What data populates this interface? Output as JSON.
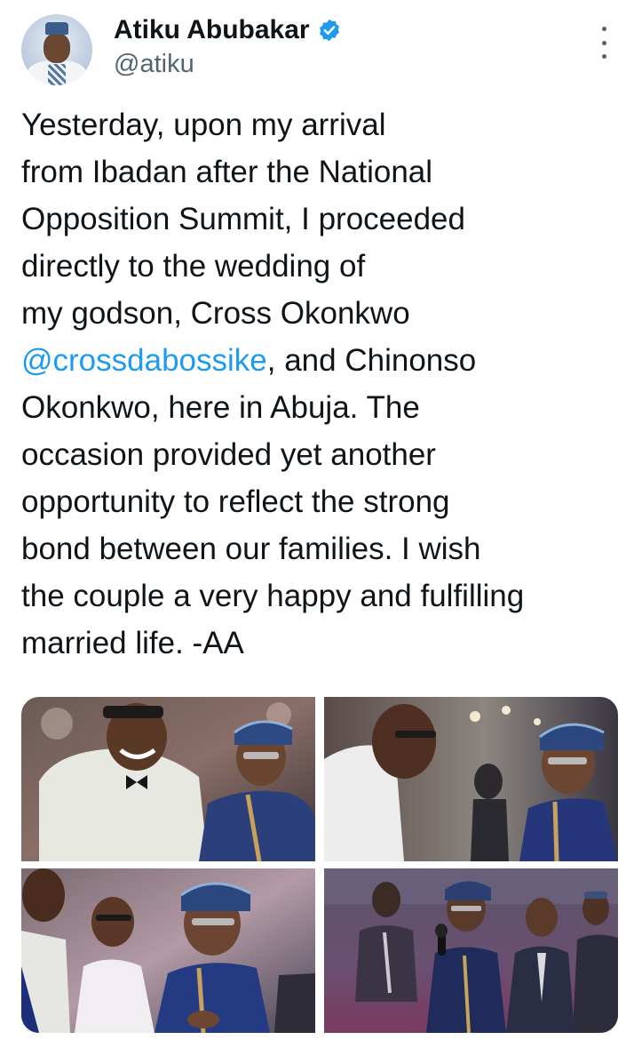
{
  "tweet": {
    "author": {
      "display_name": "Atiku Abubakar",
      "handle": "@atiku",
      "verified": true
    },
    "text_lines": [
      {
        "before": "Yesterday, upon my arrival",
        "mention": "",
        "after": ""
      },
      {
        "before": "from Ibadan after the National",
        "mention": "",
        "after": ""
      },
      {
        "before": "Opposition Summit, I proceeded",
        "mention": "",
        "after": ""
      },
      {
        "before": "directly to the wedding of",
        "mention": "",
        "after": ""
      },
      {
        "before": "my godson, Cross Okonkwo",
        "mention": "",
        "after": ""
      },
      {
        "before": "",
        "mention": "@crossdabossike",
        "after": ", and Chinonso"
      },
      {
        "before": "Okonkwo, here in Abuja. The",
        "mention": "",
        "after": ""
      },
      {
        "before": "occasion provided yet another",
        "mention": "",
        "after": ""
      },
      {
        "before": "opportunity to reflect the strong",
        "mention": "",
        "after": ""
      },
      {
        "before": "bond between our families. I wish",
        "mention": "",
        "after": ""
      },
      {
        "before": "the couple a very happy and fulfilling",
        "mention": "",
        "after": ""
      },
      {
        "before": "married life. -AA",
        "mention": "",
        "after": ""
      }
    ],
    "media_count": 4
  },
  "icons": {
    "verified": "verified-badge-icon",
    "more": "more-options-icon"
  },
  "colors": {
    "text": "#0f1419",
    "secondary": "#536471",
    "accent": "#1d9bf0"
  }
}
